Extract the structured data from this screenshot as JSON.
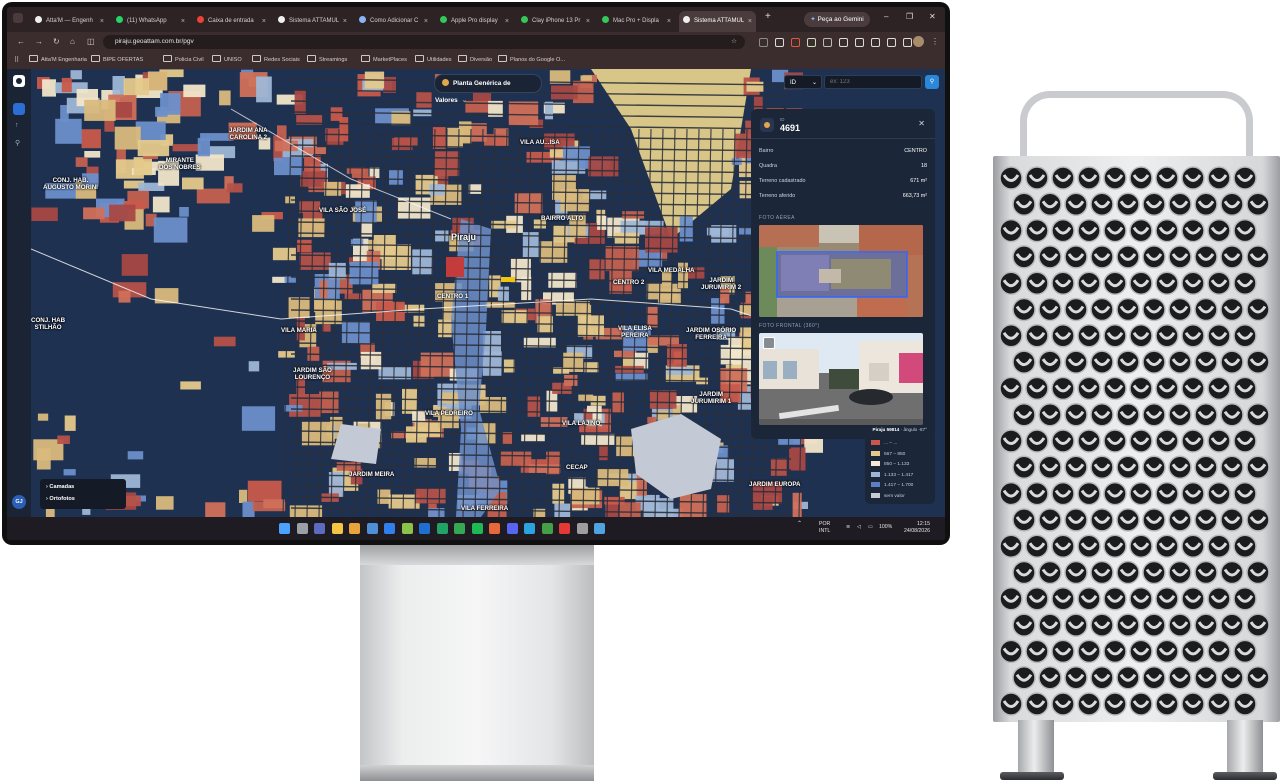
{
  "browser": {
    "tabs": [
      {
        "label": "Atta'M — Engenh",
        "color": "#f0f0f0"
      },
      {
        "label": "(11) WhatsApp",
        "color": "#25d366"
      },
      {
        "label": "Caixa de entrada",
        "color": "#ea4335"
      },
      {
        "label": "Sistema ATTAMUL",
        "color": "#f0f0f0"
      },
      {
        "label": "Como Adicionar C",
        "color": "#8ab4f8"
      },
      {
        "label": "Apple Pro display",
        "color": "#34c759"
      },
      {
        "label": "Clay iPhone 13 Pr",
        "color": "#34c759"
      },
      {
        "label": "Mac Pro + Displa",
        "color": "#34c759"
      },
      {
        "label": "Sistema ATTAMUL",
        "color": "#f0f0f0"
      }
    ],
    "new_tab": "+",
    "gemini_label": "Peça ao Gemini",
    "window_controls": {
      "minimize": "–",
      "restore": "❐",
      "close": "✕"
    },
    "url": "piraju.geoattam.com.br/pgv",
    "bookmarks": [
      "Atta'M Engenharia",
      "BIPE OFERTAS",
      "Policia Civil",
      "UNISO",
      "Redes Sociais",
      "Streamings",
      "MarketPlaces",
      "Utilidades",
      "Diversão",
      "Planos do Google O..."
    ]
  },
  "app": {
    "header_title": "Planta Genérica de Valores",
    "search_select": "ID",
    "search_placeholder": "ex: 123",
    "rail_user": "GJ",
    "map_labels": [
      "JARDIM ANA\nCAROLINA 2",
      "MIRANTE\nDOS NOBRES",
      "CONJ. HAB.\nAUGUSTO MORINI",
      "VILA SÃO JOSÉ",
      "Piraju",
      "VILA AU...ISA",
      "BAIRRO ALTO",
      "CENTRO 1",
      "CENTRO 2",
      "VILA MEDALHA",
      "JARDIM\nJURUMIRIM 2",
      "VILA ELISA\nPEREIRA",
      "JARDIM OSÓRIO\nFERREIRA",
      "VILA MARIA",
      "CONJ. HAB\nSTILHÃO",
      "JARDIM SÃO\nLOURENÇO",
      "VILA PEDREIRO",
      "VILA LAJINO",
      "JARDIM\nJURUMIRIM 1",
      "CECAP",
      "JARDIM MEIRA",
      "JARDIM EUROPA",
      "VILA FERREIRA"
    ],
    "detail": {
      "id_caption": "ID",
      "id": "4691",
      "close": "✕",
      "rows": [
        {
          "label": "Bairro",
          "value": "CENTRO"
        },
        {
          "label": "Quadra",
          "value": "18"
        },
        {
          "label": "Terreno cadastrado",
          "value": "671 m²"
        },
        {
          "label": "Terreno aferido",
          "value": "663,73 m²"
        }
      ],
      "aerial_title": "FOTO AÉREA",
      "frontal_title": "FOTO FRONTAL (360°)",
      "photo_caption_bold": "Piraju 59814",
      "photo_caption_rest": " · ângulo -87°"
    },
    "legend": [
      {
        "label": "... – ...",
        "color": "#c9574a"
      },
      {
        "label": "567 – 850",
        "color": "#e5c98b"
      },
      {
        "label": "850 – 1.133",
        "color": "#f3ebd7"
      },
      {
        "label": "1.133 – 1.417",
        "color": "#9fb7d6"
      },
      {
        "label": "1.417 – 1.700",
        "color": "#5b7fc2"
      },
      {
        "label": "sem valor",
        "color": "#c8ccd2"
      }
    ],
    "layers": [
      {
        "label": "Camadas"
      },
      {
        "label": "Ortofotos"
      }
    ]
  },
  "taskbar": {
    "lang_top": "POR",
    "lang_bottom": "INTL",
    "battery": "100%",
    "time": "12:15",
    "date": "24/08/2026"
  }
}
